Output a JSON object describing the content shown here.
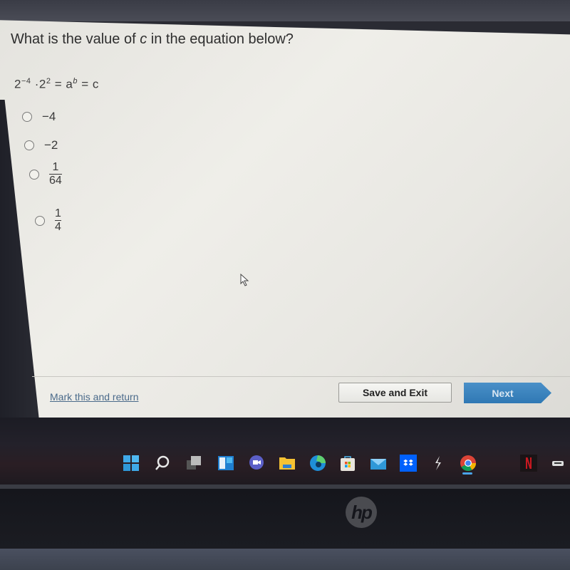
{
  "question": {
    "prefix": "What is the value of ",
    "variable": "c",
    "suffix": " in the equation below?"
  },
  "equation": {
    "base1": "2",
    "exp1": "−4",
    "dot": "·",
    "base2": "2",
    "exp2": "2",
    "eq1": " = ",
    "a": "a",
    "exp_b": "b",
    "eq2": " = ",
    "c": "c"
  },
  "options": [
    {
      "label": "−4",
      "selected": false
    },
    {
      "label": "−2",
      "selected": false
    },
    {
      "numerator": "1",
      "denominator": "64",
      "selected": false
    },
    {
      "numerator": "1",
      "denominator": "4",
      "selected": false
    }
  ],
  "footer": {
    "mark_link": "Mark this and return",
    "save_button": "Save and Exit",
    "next_button": "Next"
  },
  "taskbar": {
    "icons": [
      "windows-start-icon",
      "search-icon",
      "task-view-icon",
      "widgets-icon",
      "teams-chat-icon",
      "file-explorer-icon",
      "edge-icon",
      "microsoft-store-icon",
      "mail-icon",
      "dropbox-icon",
      "app-icon",
      "chrome-icon",
      "netflix-icon",
      "tray-icon"
    ],
    "active": "chrome-icon"
  },
  "laptop": {
    "brand_logo": "hp"
  }
}
